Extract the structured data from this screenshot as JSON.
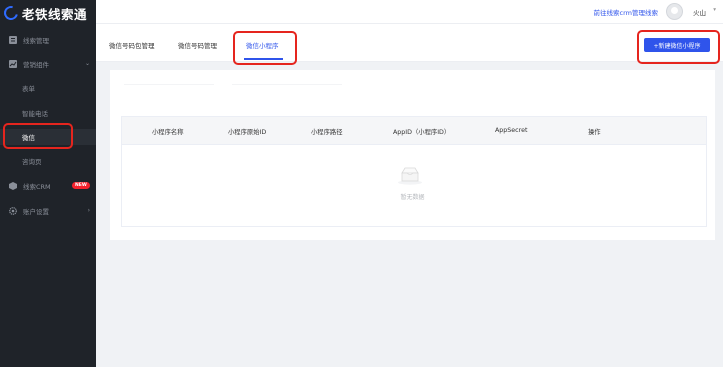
{
  "app": {
    "logo_text": "老铁线索通"
  },
  "sidebar": {
    "items": [
      {
        "label": "线索管理"
      },
      {
        "label": "营销组件"
      },
      {
        "label": "表单"
      },
      {
        "label": "智能电话"
      },
      {
        "label": "微信"
      },
      {
        "label": "咨询页"
      },
      {
        "label": "线索CRM",
        "badge": "NEW"
      },
      {
        "label": "账户设置"
      }
    ]
  },
  "header": {
    "crm_link": "前往线索crm管理线索",
    "user_name": "火山"
  },
  "tabs": [
    {
      "label": "微信号码包管理"
    },
    {
      "label": "微信号码管理"
    },
    {
      "label": "微信小程序",
      "active": true
    }
  ],
  "toolbar": {
    "new_button": "+新建微信小程序"
  },
  "table": {
    "columns": [
      "小程序名称",
      "小程序原始ID",
      "小程序路径",
      "AppID（小程序ID）",
      "AppSecret",
      "操作"
    ],
    "rows": [],
    "empty_text": "暂无数据"
  },
  "colors": {
    "accent": "#2f54eb",
    "sidebar_bg": "#1f2329",
    "highlight": "#e5251e",
    "badge": "#f5222d"
  }
}
